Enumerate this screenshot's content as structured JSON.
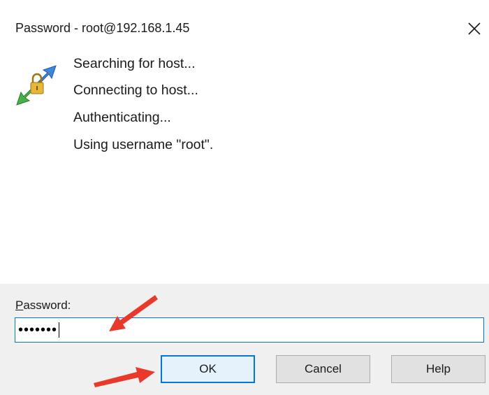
{
  "dialog": {
    "title": "Password - root@192.168.1.45",
    "close_icon": "close-icon",
    "app_icon": "putty-key-exchange-icon"
  },
  "messages": [
    "Searching for host...",
    "Connecting to host...",
    "Authenticating...",
    "Using username \"root\"."
  ],
  "password": {
    "label_underlined": "P",
    "label_rest": "assword:",
    "value_masked": "•••••••"
  },
  "buttons": {
    "ok": "OK",
    "cancel": "Cancel",
    "help": "Help"
  },
  "colors": {
    "focus_blue": "#0078d7",
    "annotation_arrow": "#e8392b",
    "panel_bg": "#f0f0f0"
  }
}
